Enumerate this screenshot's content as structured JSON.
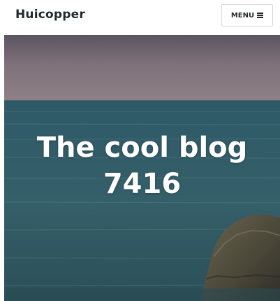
{
  "header": {
    "site_title": "Huicopper",
    "menu_label": "MENU"
  },
  "hero": {
    "title_line1": "The cool blog",
    "title_line2": "7416"
  },
  "colors": {
    "title_text": "#1f2a2e",
    "hero_text": "#ffffff",
    "sea": "#2f5d66",
    "sky": "#8a7b7f"
  },
  "icons": {
    "menu": "hamburger-icon"
  }
}
